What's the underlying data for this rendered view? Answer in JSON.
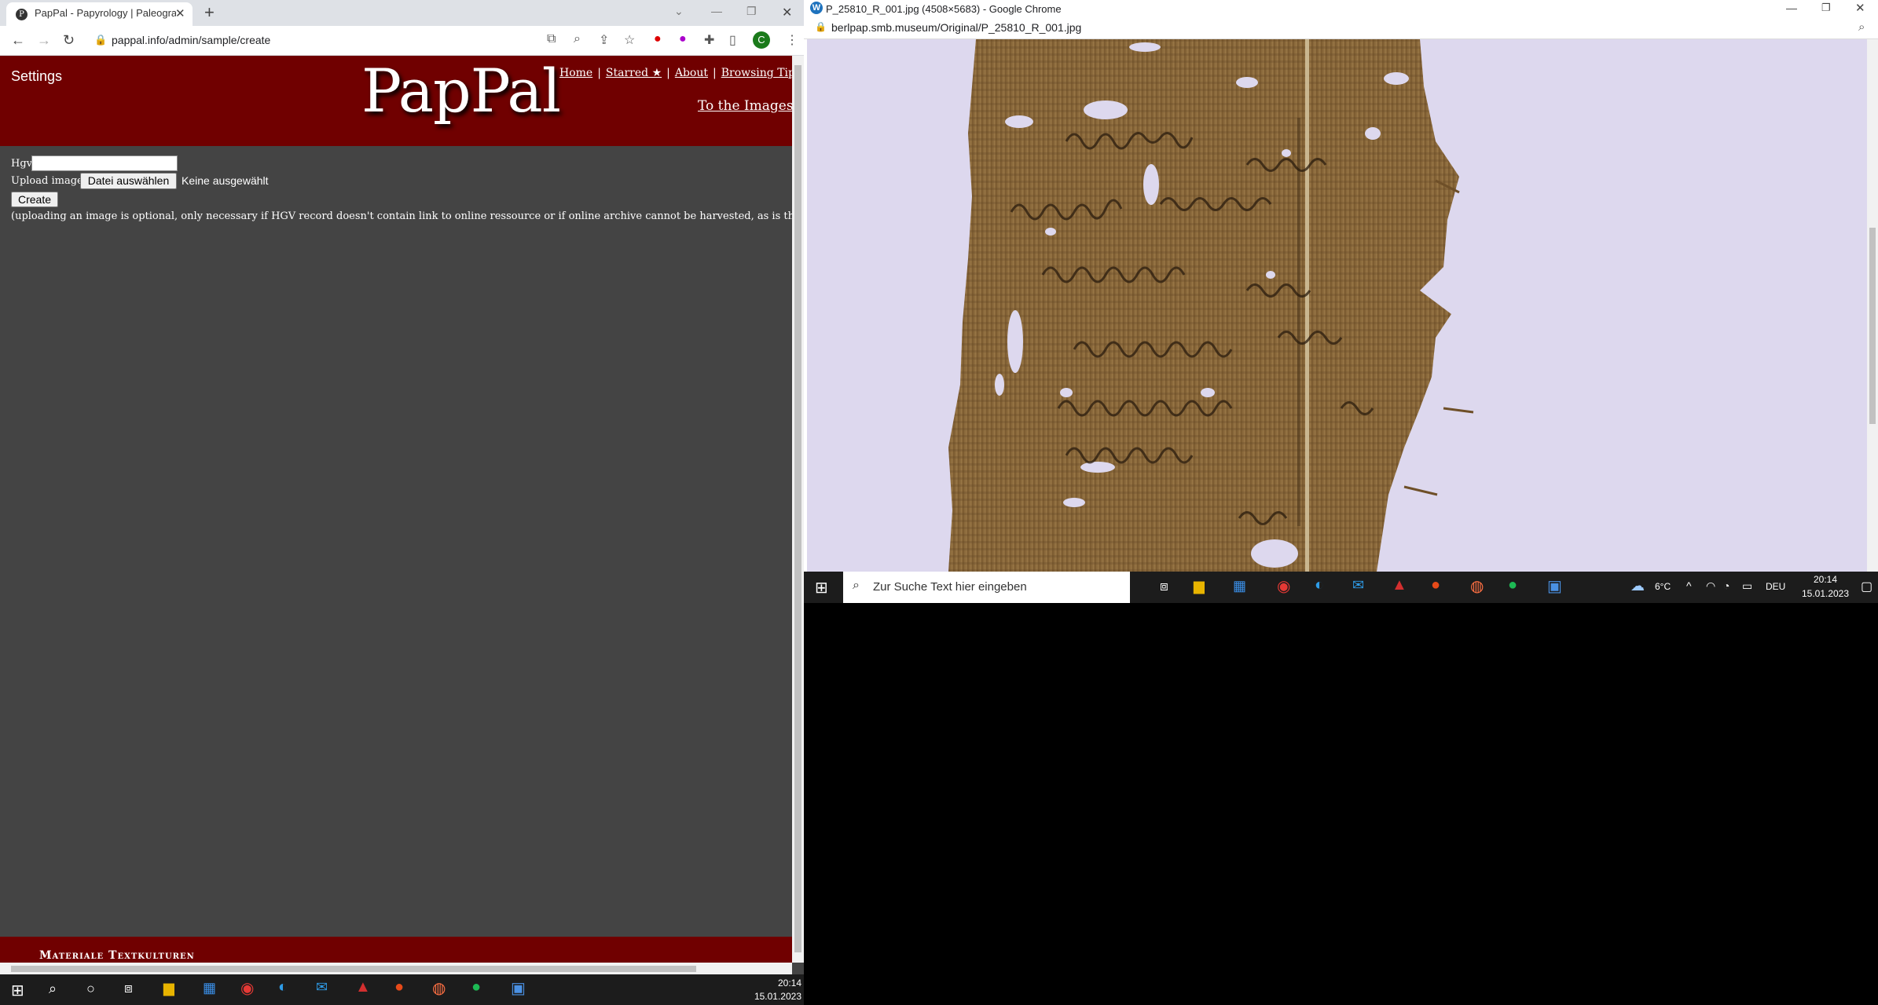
{
  "left_window": {
    "tab_title": "PapPal - Papyrology | Paleograph",
    "url": "pappal.info/admin/sample/create",
    "header": {
      "settings": "Settings",
      "logo": "PapPal",
      "nav": [
        "Home",
        "Starred ★",
        "About",
        "Browsing Tips"
      ],
      "to_images": "To the Images ..."
    },
    "form": {
      "hgv_label": "Hgv",
      "upload_label": "Upload image",
      "file_button": "Datei auswählen",
      "file_status": "Keine ausgewählt",
      "create_button": "Create",
      "note": "(uploading an image is optional, only necessary if HGV record doesn't contain link to online ressource or if online archive cannot be harvested, as is the case for"
    },
    "footer_text": "Materiale Textkulturen"
  },
  "right_window": {
    "title": "P_25810_R_001.jpg (4508×5683) - Google Chrome",
    "url": "berlpap.smb.museum/Original/P_25810_R_001.jpg",
    "taskbar": {
      "search_placeholder": "Zur Suche Text hier eingeben",
      "weather": "6°C",
      "lang": "DEU",
      "time": "20:14",
      "date": "15.01.2023"
    }
  },
  "main_taskbar": {
    "time": "20:14",
    "date": "15.01.2023"
  },
  "colors": {
    "header_red": "#700000",
    "body_gray": "#444444",
    "viewer_bg": "#ddd8ee",
    "papyrus": "#8a6638"
  }
}
